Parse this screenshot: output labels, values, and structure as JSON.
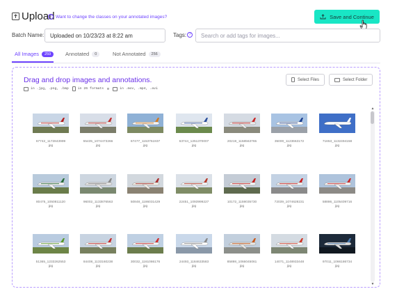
{
  "header": {
    "title": "Upload",
    "help_link": "Want to change the classes on your annotated images?",
    "save_button": "Save and Continue"
  },
  "batch": {
    "label": "Batch Name:",
    "value": "Uploaded on 10/23/23 at 8:22 am"
  },
  "tags": {
    "label": "Tags:",
    "placeholder": "Search or add tags for images..."
  },
  "tabs": [
    {
      "label": "All Images",
      "count": "259",
      "active": true
    },
    {
      "label": "Annotated",
      "count": "0",
      "active": false
    },
    {
      "label": "Not Annotated",
      "count": "256",
      "active": false
    }
  ],
  "dropzone": {
    "title": "Drag and drop images and annotations.",
    "image_formats": "in .jpg, .png, .bmp",
    "annotation_formats": "in 26 formats",
    "video_formats": "in .mov, .mp4, .avi",
    "select_files": "Select Files",
    "select_folder": "Select Folder"
  },
  "images": [
    {
      "name": "67742_1172843999",
      "ext": "jpg",
      "sky": "#c9d6e6",
      "ground": "#6f7a52",
      "plane": "#ffffff",
      "accent": "#b52020"
    },
    {
      "name": "55435_1074473266",
      "ext": "jpg",
      "sky": "#d8dee8",
      "ground": "#7b7d6a",
      "plane": "#f0f0f0",
      "accent": "#c03030"
    },
    {
      "name": "67477_1153751937",
      "ext": "jpg",
      "sky": "#8fb1d6",
      "ground": "#7d8a62",
      "plane": "#f4f4f4",
      "accent": "#d47a20"
    },
    {
      "name": "63744_1251370007",
      "ext": "jpg",
      "sky": "#dfe6ef",
      "ground": "#6b8a4c",
      "plane": "#ffffff",
      "accent": "#2a4f9c"
    },
    {
      "name": "20219_1158563765",
      "ext": "jpg",
      "sky": "#d5dbe3",
      "ground": "#8a8a7c",
      "plane": "#ebebeb",
      "accent": "#c92828"
    },
    {
      "name": "35000_1123663172",
      "ext": "jpg",
      "sky": "#a8c3e3",
      "ground": "#9aa0a8",
      "plane": "#ffffff",
      "accent": "#1a3f8f"
    },
    {
      "name": "71653_1132494158",
      "ext": "jpg",
      "sky": "#3f6fc7",
      "ground": "#3f6fc7",
      "plane": "#ffffff",
      "accent": "#ffffff"
    },
    {
      "name": "80475_1050811120",
      "ext": "jpg",
      "sky": "#b8cadc",
      "ground": "#6a7c4a",
      "plane": "#f2f2f2",
      "accent": "#2a6e3a"
    },
    {
      "name": "96002_1133876563",
      "ext": "jpg",
      "sky": "#cdd6e0",
      "ground": "#7a8870",
      "plane": "#e6e6e6",
      "accent": "#8a8a8a"
    },
    {
      "name": "50848_1186031429",
      "ext": "jpg",
      "sky": "#d2d8de",
      "ground": "#8a8272",
      "plane": "#f0ece4",
      "accent": "#a83030"
    },
    {
      "name": "22451_1093999227",
      "ext": "jpg",
      "sky": "#dbe1e8",
      "ground": "#7f8c66",
      "plane": "#f5f5f5",
      "accent": "#b83b2b"
    },
    {
      "name": "10172_1159035730",
      "ext": "jpg",
      "sky": "#c4ccd6",
      "ground": "#5e6a4e",
      "plane": "#f4f4f4",
      "accent": "#c41e1e"
    },
    {
      "name": "72039_1074628231",
      "ext": "jpg",
      "sky": "#c3d2e4",
      "ground": "#8a8a8a",
      "plane": "#f0f0f0",
      "accent": "#c92020"
    },
    {
      "name": "58886_1105409716",
      "ext": "jpg",
      "sky": "#aec3dc",
      "ground": "#8c8a86",
      "plane": "#f2f2f2",
      "accent": "#cc2a2a"
    },
    {
      "name": "51365_1233262553",
      "ext": "jpg",
      "sky": "#b9cbe0",
      "ground": "#6d8546",
      "plane": "#ffffff",
      "accent": "#5a9a2a"
    },
    {
      "name": "84408_1133160238",
      "ext": "jpg",
      "sky": "#c7d3e1",
      "ground": "#77805e",
      "plane": "#f4f4f4",
      "accent": "#c42a2a"
    },
    {
      "name": "30032_1161086176",
      "ext": "jpg",
      "sky": "#bfd0e3",
      "ground": "#6c7d4d",
      "plane": "#f4f4f4",
      "accent": "#d03030"
    },
    {
      "name": "24493_1184633583",
      "ext": "jpg",
      "sky": "#c9d8ea",
      "ground": "#8a98a8",
      "plane": "#ffffff",
      "accent": "#8a8a8a"
    },
    {
      "name": "85898_1066045061",
      "ext": "jpg",
      "sky": "#c2cfdd",
      "ground": "#8c8f8a",
      "plane": "#e8e6e2",
      "accent": "#c85a1e"
    },
    {
      "name": "14071_1148933448",
      "ext": "jpg",
      "sky": "#d4dbe2",
      "ground": "#7d8673",
      "plane": "#f6f6f6",
      "accent": "#cc3a2a"
    },
    {
      "name": "97011_1066186734",
      "ext": "jpg",
      "sky": "#1d2a3a",
      "ground": "#101820",
      "plane": "#dcdcdc",
      "accent": "#4a7ab0"
    }
  ]
}
